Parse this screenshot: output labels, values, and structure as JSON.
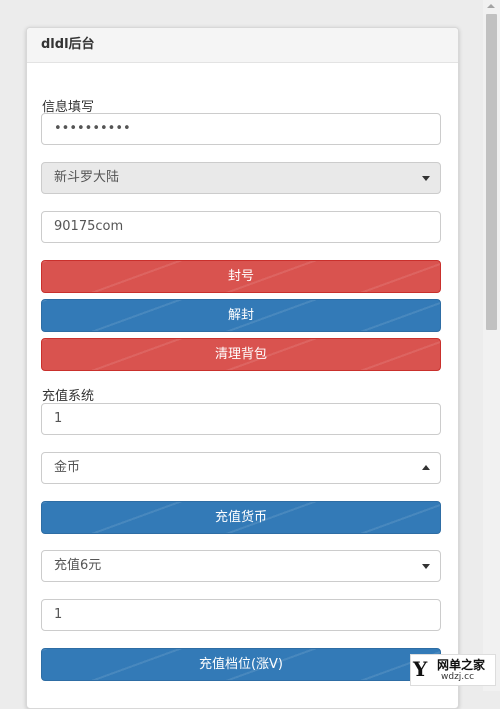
{
  "panel": {
    "title": "dldl后台"
  },
  "info_label": "信息填写",
  "password_field": {
    "value": "••••••••••"
  },
  "server_select": {
    "value": "新斗罗大陆"
  },
  "account_field": {
    "value": "90175com"
  },
  "buttons": {
    "ban": "封号",
    "unban": "解封",
    "clear_bag": "清理背包",
    "recharge_currency": "充值货币",
    "recharge_tier": "充值档位(涨V)"
  },
  "recharge_label": "充值系统",
  "currency_amount_field": {
    "value": "1"
  },
  "currency_select": {
    "value": "金币"
  },
  "tier_select": {
    "value": "充值6元"
  },
  "tier_amount_field": {
    "value": "1"
  },
  "watermark": {
    "logo": "Y",
    "title": "网单之家",
    "url": "wdzj.cc"
  },
  "colors": {
    "danger": "#d9534f",
    "primary": "#337ab7"
  }
}
